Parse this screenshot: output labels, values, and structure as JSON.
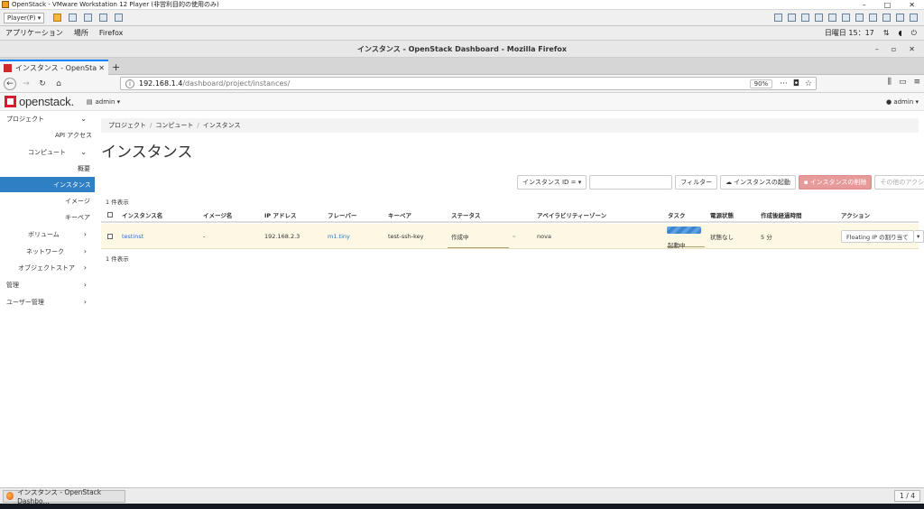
{
  "vmware": {
    "window_title": "OpenStack - VMware Workstation 12 Player (非営利目的の使用のみ)",
    "player_menu": "Player(P)",
    "winbtns": [
      "–",
      "□",
      "✕"
    ]
  },
  "gnome": {
    "menu": [
      "アプリケーション",
      "場所",
      "Firefox"
    ],
    "clock": "日曜日 15：17",
    "sys_icons": [
      "network-icon",
      "volume-icon",
      "power-icon"
    ]
  },
  "firefox": {
    "window_title": "インスタンス - OpenStack Dashboard - Mozilla Firefox",
    "winbtns": [
      "–",
      "▫",
      "✕"
    ],
    "tab_title": "インスタンス - OpenSta",
    "url_host": "192.168.1.4",
    "url_path": "/dashboard/project/instances/",
    "zoom": "90%"
  },
  "header": {
    "logo_text": "openstack.",
    "project": "admin ▾",
    "user": "admin ▾"
  },
  "sidebar": {
    "items": [
      {
        "label": "プロジェクト",
        "chev": "⌄"
      },
      {
        "label": "API アクセス",
        "chev": ""
      },
      {
        "label": "コンピュート",
        "chev": "⌄"
      },
      {
        "label": "概要",
        "chev": ""
      },
      {
        "label": "インスタンス",
        "chev": ""
      },
      {
        "label": "イメージ",
        "chev": ""
      },
      {
        "label": "キーペア",
        "chev": ""
      },
      {
        "label": "ボリューム",
        "chev": "›"
      },
      {
        "label": "ネットワーク",
        "chev": "›"
      },
      {
        "label": "オブジェクトストア",
        "chev": "›"
      },
      {
        "label": "管理",
        "chev": "›"
      },
      {
        "label": "ユーザー管理",
        "chev": "›"
      }
    ]
  },
  "breadcrumb": [
    "プロジェクト",
    "コンピュート",
    "インスタンス"
  ],
  "breadcrumb_sep": "/",
  "page_title": "インスタンス",
  "filter": {
    "select": "インスタンス ID = ▾",
    "input_value": "",
    "filter_btn": "フィルター",
    "launch_btn": "インスタンスの起動",
    "delete_btn": "インスタンスの削除",
    "more_btn": "その他のアクション ▾"
  },
  "count_top": "1 件表示",
  "count_bottom": "1 件表示",
  "table": {
    "headers": [
      "インスタンス名",
      "イメージ名",
      "IP アドレス",
      "フレーバー",
      "キーペア",
      "ステータス",
      "アベイラビリティーゾーン",
      "タスク",
      "電源状態",
      "作成後経過時間",
      "アクション"
    ],
    "row": {
      "name": "testinst",
      "image": "-",
      "ip": "192.168.2.3",
      "flavor": "m1.tiny",
      "keypair": "test-ssh-key",
      "status": "作成中",
      "az": "nova",
      "task": "起動中",
      "power": "状態なし",
      "age": "5 分",
      "action": "Floating IP の割り当て",
      "action_caret": "▾"
    }
  },
  "bottom": {
    "task_label": "インスタンス - OpenStack Dashbo…",
    "pager": "1 / 4"
  }
}
